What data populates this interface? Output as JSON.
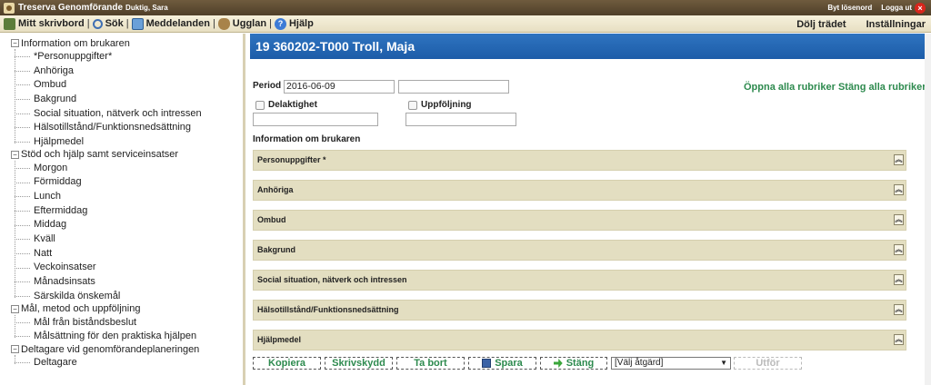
{
  "titlebar": {
    "app_name": "Treserva Genomförande",
    "user_name": "Duktig, Sara",
    "change_password": "Byt lösenord",
    "logout": "Logga ut",
    "logout_icon": "close-icon"
  },
  "menubar": {
    "items": [
      {
        "label": "Mitt skrivbord",
        "icon": "desk-icon"
      },
      {
        "label": "Sök",
        "icon": "search-icon"
      },
      {
        "label": "Meddelanden",
        "icon": "mail-icon"
      },
      {
        "label": "Ugglan",
        "icon": "owl-icon"
      },
      {
        "label": "Hjälp",
        "icon": "help-icon"
      }
    ],
    "hide_tree": "Dölj trädet",
    "settings": "Inställningar"
  },
  "tree": {
    "groups": [
      {
        "label": "Information om brukaren",
        "items": [
          "*Personuppgifter*",
          "Anhöriga",
          "Ombud",
          "Bakgrund",
          "Social situation, nätverk och intressen",
          "Hälsotillstånd/Funktionsnedsättning",
          "Hjälpmedel"
        ]
      },
      {
        "label": "Stöd och hjälp samt serviceinsatser",
        "items": [
          "Morgon",
          "Förmiddag",
          "Lunch",
          "Eftermiddag",
          "Middag",
          "Kväll",
          "Natt",
          "Veckoinsatser",
          "Månadsinsats",
          "Särskilda önskemål"
        ]
      },
      {
        "label": "Mål, metod och uppföljning",
        "items": [
          "Mål från biståndsbeslut",
          "Målsättning för den praktiska hjälpen"
        ]
      },
      {
        "label": "Deltagare vid genomförandeplaneringen",
        "items": [
          "Deltagare"
        ]
      }
    ]
  },
  "main": {
    "header": "19 360202-T000 Troll, Maja",
    "period_label": "Period",
    "period_from": "2016-06-09",
    "period_to": "",
    "delaktighet_label": "Delaktighet",
    "delaktighet_value": "",
    "uppfoljning_label": "Uppföljning",
    "uppfoljning_value": "",
    "open_all": "Öppna alla rubriker",
    "close_all": "Stäng alla rubriker",
    "section_title": "Information om brukaren",
    "sections": [
      "Personuppgifter *",
      "Anhöriga",
      "Ombud",
      "Bakgrund",
      "Social situation, nätverk och intressen",
      "Hälsotillstånd/Funktionsnedsättning",
      "Hjälpmedel"
    ]
  },
  "actions": {
    "copy": "Kopiera",
    "write_protect": "Skrivskydd",
    "delete": "Ta bort",
    "save": "Spara",
    "close": "Stäng",
    "select_action": "[Välj åtgärd]",
    "execute": "Utför"
  },
  "colors": {
    "header_blue": "#1c5ca8",
    "link_green": "#2d8a4e",
    "section_beige": "#e3dec1"
  }
}
